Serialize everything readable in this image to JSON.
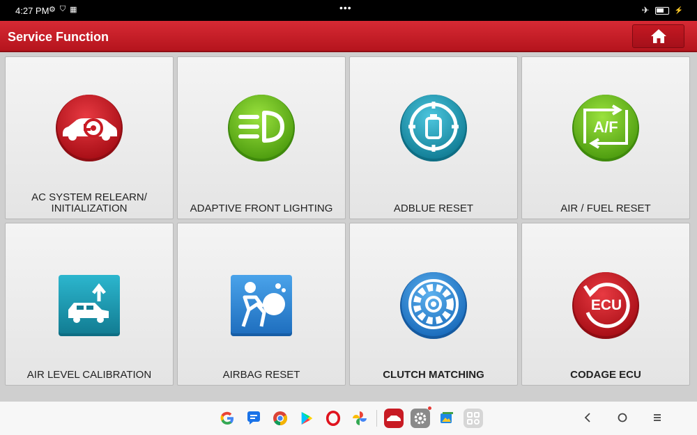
{
  "status_bar": {
    "time": "4:27 PM",
    "dots": "•••"
  },
  "header": {
    "title": "Service Function"
  },
  "tiles": [
    {
      "label": "AC SYSTEM RELEARN/\nINITIALIZATION"
    },
    {
      "label": "ADAPTIVE FRONT LIGHTING"
    },
    {
      "label": "ADBLUE RESET"
    },
    {
      "label": "AIR / FUEL RESET"
    },
    {
      "label": "AIR LEVEL CALIBRATION"
    },
    {
      "label": "AIRBAG RESET"
    },
    {
      "label": "CLUTCH MATCHING"
    },
    {
      "label": "CODAGE ECU"
    }
  ],
  "icon_text": {
    "af": "A/F",
    "ecu": "ECU"
  },
  "colors": {
    "accent_red": "#c81b24",
    "green": "#6cc61f",
    "teal": "#22a7c2",
    "blue": "#2f8fd6"
  }
}
